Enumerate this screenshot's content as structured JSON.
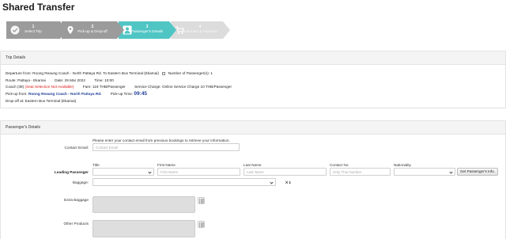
{
  "page": {
    "title": "Shared Transfer"
  },
  "steps": [
    {
      "num": "1",
      "label": "Select Trip",
      "state": "done",
      "icon": "check-icon"
    },
    {
      "num": "2",
      "label": "Pick-up & Drop-off",
      "state": "done",
      "icon": "map-pin-icon"
    },
    {
      "num": "3",
      "label": "Passenger's Details",
      "state": "active",
      "icon": "user-icon"
    },
    {
      "num": "4",
      "label": "Summary & Payment",
      "state": "todo",
      "icon": "cart-icon"
    }
  ],
  "trip": {
    "header": "Trip Details",
    "departure": "Departure from: Roong Reaung Coach - North Pattaya Rd. To Eastern Bus Terminal (Ekamai)",
    "passengers": "Number of Passenger(s): 1",
    "route": "Route: Pattaya - Ekamai",
    "date": "Date: 29 Mar 2022",
    "time": "Time: 10:00",
    "coach": "Coach (38)",
    "coach_note": "(Seat Selection Not Available)",
    "fare": "Fare: 119 THB/Passenger",
    "service": "Service Charge: Online Service Charge 10 THB/Passenger",
    "pickup_label": "Pick-up from:",
    "pickup_value": "Roong Reaung Coach - North Pattaya Rd.",
    "pickup_time_label": "Pick-up Time:",
    "pickup_time_value": "09:45",
    "dropoff": "Drop-off at: Eastern Bus Terminal (Ekamai)"
  },
  "passenger": {
    "header": "Passenger's Details",
    "contact_hint": "Please enter your contact email from previous bookings to retrieve your information.",
    "contact_label": "Contact Email:",
    "contact_placeholder": "Contact Email",
    "leading_label": "Leading Passenger",
    "col_title": "Title",
    "col_first": "First Name",
    "first_placeholder": "First Name",
    "col_last": "Last Name",
    "last_placeholder": "Last Name",
    "col_contact": "Contact No.",
    "contact_no_placeholder": "Only Thai Number",
    "col_nationality": "Nationality",
    "get_info_button": "Get Passenger's Info.",
    "baggage_label": "Baggage:",
    "baggage_qty": "X 1",
    "extra_baggage_label": "Extra Baggage",
    "other_products_label": "Other Products"
  }
}
